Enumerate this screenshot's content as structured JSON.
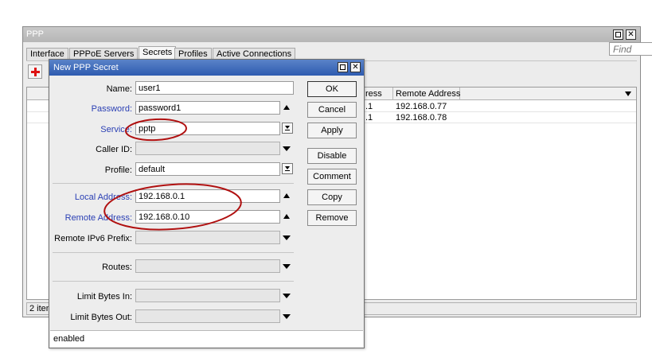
{
  "ppp_window": {
    "title": "PPP",
    "tabs": [
      "Interface",
      "PPPoE Servers",
      "Secrets",
      "Profiles",
      "Active Connections"
    ],
    "active_tab": "Secrets",
    "find_placeholder": "Find",
    "table": {
      "columns": [
        "ress",
        "Remote Address"
      ],
      "rows": [
        {
          "local_fragment": ".1",
          "remote_address": "192.168.0.77"
        },
        {
          "local_fragment": ".1",
          "remote_address": "192.168.0.78"
        }
      ]
    },
    "items_count": "2 item"
  },
  "dialog": {
    "title": "New PPP Secret",
    "fields": {
      "name": {
        "label": "Name:",
        "value": "user1"
      },
      "password": {
        "label": "Password:",
        "value": "password1"
      },
      "service": {
        "label": "Service:",
        "value": "pptp"
      },
      "caller_id": {
        "label": "Caller ID:",
        "value": ""
      },
      "profile": {
        "label": "Profile:",
        "value": "default"
      },
      "local_address": {
        "label": "Local Address:",
        "value": "192.168.0.1"
      },
      "remote_address": {
        "label": "Remote Address:",
        "value": "192.168.0.10"
      },
      "remote_ipv6_prefix": {
        "label": "Remote IPv6 Prefix:",
        "value": ""
      },
      "routes": {
        "label": "Routes:",
        "value": ""
      },
      "limit_bytes_in": {
        "label": "Limit Bytes In:",
        "value": ""
      },
      "limit_bytes_out": {
        "label": "Limit Bytes Out:",
        "value": ""
      }
    },
    "buttons": {
      "ok": "OK",
      "cancel": "Cancel",
      "apply": "Apply",
      "disable": "Disable",
      "comment": "Comment",
      "copy": "Copy",
      "remove": "Remove"
    },
    "status": "enabled"
  },
  "colors": {
    "label_highlight": "#2a3fb4",
    "dialog_titlebar": "#2e5bb0",
    "annotation": "#b01010"
  }
}
